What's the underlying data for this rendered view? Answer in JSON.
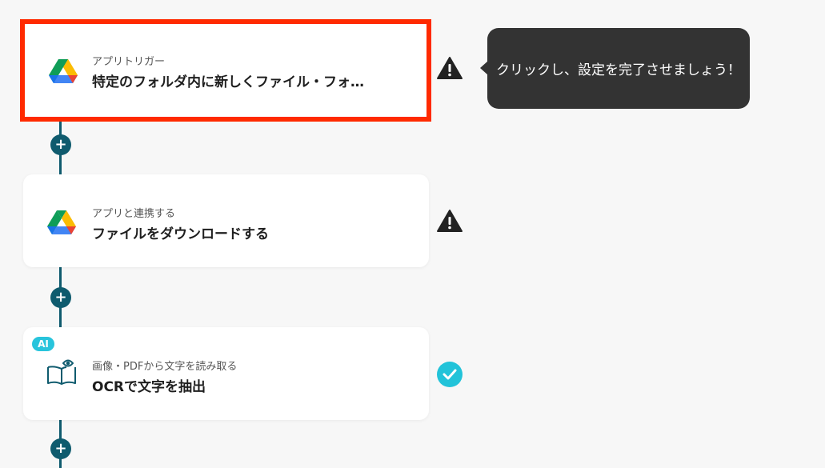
{
  "flow": {
    "steps": [
      {
        "subtitle": "アプリトリガー",
        "title": "特定のフォルダ内に新しくファイル・フォ…",
        "icon": "google-drive-icon",
        "status": "warning",
        "selected": true
      },
      {
        "subtitle": "アプリと連携する",
        "title": "ファイルをダウンロードする",
        "icon": "google-drive-icon",
        "status": "warning",
        "selected": false
      },
      {
        "subtitle": "画像・PDFから文字を読み取る",
        "title": "OCRで文字を抽出",
        "icon": "book-eye-icon",
        "badge": "AI",
        "status": "completed",
        "selected": false
      }
    ],
    "add_step_symbol": "+"
  },
  "tooltip": {
    "text": "クリックし、設定を完了させましょう！"
  },
  "colors": {
    "connector": "#0f5b6e",
    "selection_border": "#ff2a00",
    "ai_badge": "#28c4dc",
    "check": "#22c3d9",
    "tooltip_bg": "#333333"
  }
}
